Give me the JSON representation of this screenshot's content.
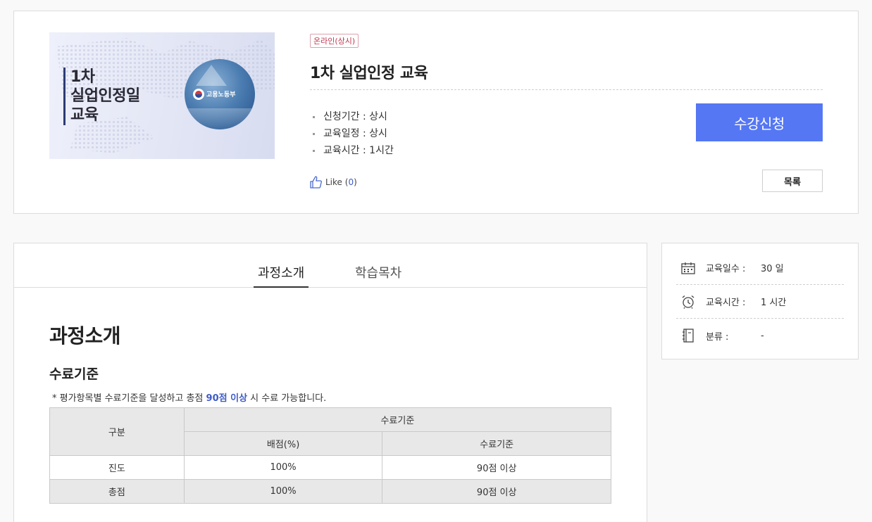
{
  "course": {
    "badge": "온라인(상시)",
    "title": "1차 실업인정 교육",
    "thumbnail": {
      "title": "1차\n실업인정일\n교육",
      "ministry": "고용노동부"
    },
    "info": [
      {
        "label": "신청기간",
        "value": "상시"
      },
      {
        "label": "교육일정",
        "value": "상시"
      },
      {
        "label": "교육시간",
        "value": "1시간"
      }
    ],
    "like_label": "Like",
    "like_count": "0",
    "enroll_label": "수강신청",
    "list_label": "목록"
  },
  "tabs": [
    {
      "label": "과정소개",
      "active": true
    },
    {
      "label": "학습목차",
      "active": false
    }
  ],
  "content": {
    "section_title": "과정소개",
    "sub_title": "수료기준",
    "note_prefix": "* 평가항목별 수료기준을 달성하고 총점 ",
    "note_highlight": "90점 이상",
    "note_suffix": " 시 수료 가능합니다.",
    "table": {
      "head_col1": "구분",
      "head_group": "수료기준",
      "head_col2": "배점(%)",
      "head_col3": "수료기준",
      "rows": [
        {
          "category": "진도",
          "score": "100%",
          "criteria": "90점 이상"
        },
        {
          "category": "총점",
          "score": "100%",
          "criteria": "90점 이상"
        }
      ]
    }
  },
  "side": {
    "items": [
      {
        "icon": "calendar-icon",
        "label": "교육일수 :",
        "value": "30 일"
      },
      {
        "icon": "alarm-clock-icon",
        "label": "교육시간 :",
        "value": "1 시간"
      },
      {
        "icon": "notebook-icon",
        "label": "분류 :",
        "value": "-"
      }
    ]
  },
  "colors": {
    "primary_button": "#5577f4",
    "badge": "#c3364f",
    "highlight": "#3f5cc7"
  }
}
